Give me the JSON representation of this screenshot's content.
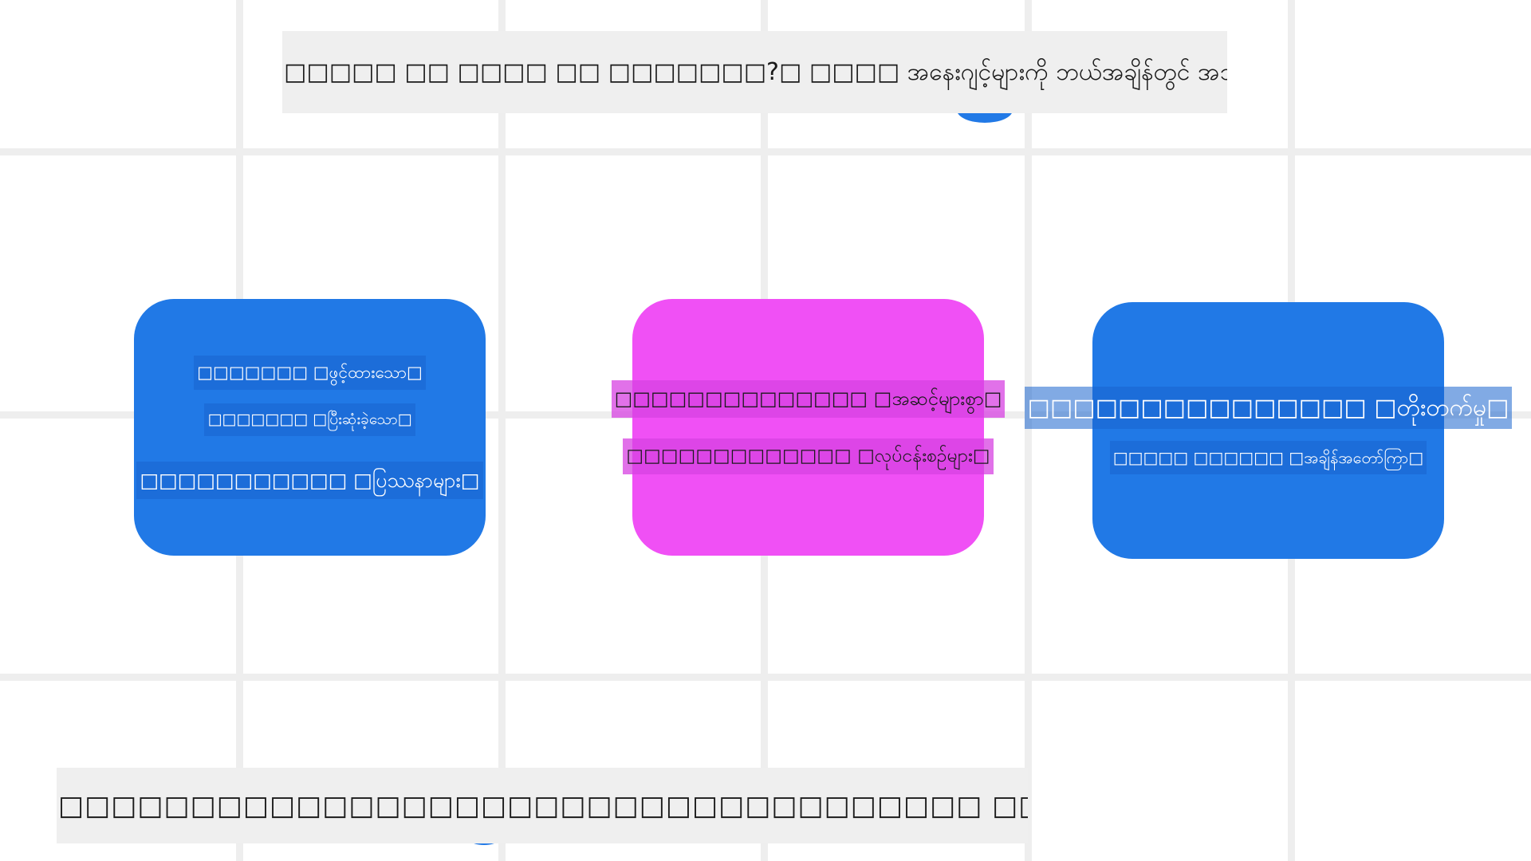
{
  "diagram": {
    "title": "□□□□□ □□ □□□□ □□ □□□□□□□?□ □□□□ အနေးဂျင့်များကို ဘယ်အချိန်တွင် အသုံးပြုရမလဲ?□",
    "caption": "□□□□□□□□□□□□□□□□□□□□□□□□□□□□□□□□□□□ □□□□□□□□□□□□□□□□□□□□□□□□□□□□□□□□□□□□□",
    "cards": [
      {
        "color": "#2179e6",
        "items": [
          "□□□□□□□ □ဖွင့်ထားသော□",
          "□□□□□□□ □ပြီးဆုံးခဲ့သော□",
          "□□□□□□□□□□□ □ပြဿနာများ□"
        ]
      },
      {
        "color": "#f050f5",
        "items": [
          "□□□□□□□□□□□□□□ □အဆင့်များစွာ□",
          "□□□□□□□□□□□□□ □လုပ်ငန်းစဉ်များ□"
        ]
      },
      {
        "color": "#2179e6",
        "items": [
          "□□□□□□□□□□□□□□□ □တိုးတက်မှု□",
          "□□□□□ □□□□□□ □အချိန်အတော်ကြာ□"
        ]
      }
    ]
  },
  "colors": {
    "background": "#ffffff",
    "grid": "#eeeeee",
    "label_background": "#efefef",
    "accent_blue": "#2179e6",
    "accent_pink": "#f050f5"
  }
}
